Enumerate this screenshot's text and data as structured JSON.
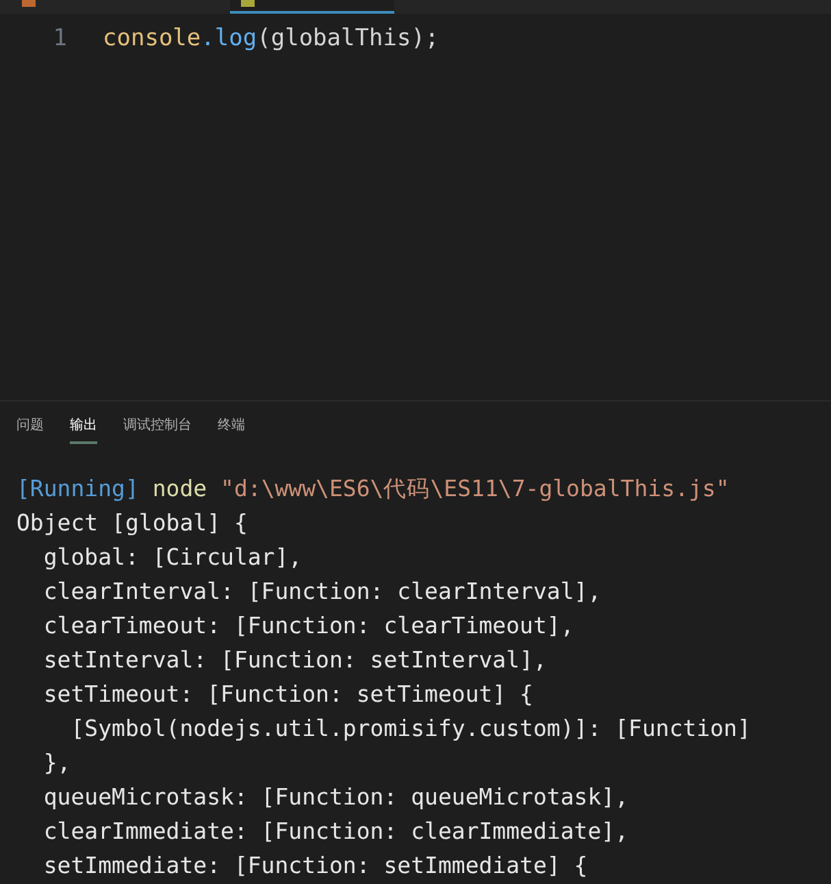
{
  "editor_tabs": [
    {
      "kind": "html",
      "selected": false
    },
    {
      "kind": "js",
      "selected": true
    }
  ],
  "code_lines": [
    {
      "number": "1",
      "tokens": [
        {
          "kind": "object",
          "text": "console"
        },
        {
          "kind": "method",
          "text": ".log"
        },
        {
          "kind": "punct",
          "text": "(globalThis);"
        }
      ]
    }
  ],
  "panel_tabs": [
    {
      "label": "问题",
      "selected": false
    },
    {
      "label": "输出",
      "selected": true
    },
    {
      "label": "调试控制台",
      "selected": false
    },
    {
      "label": "终端",
      "selected": false
    }
  ],
  "output_lines": [
    {
      "tokens": [
        {
          "kind": "status",
          "text": "[Running]"
        },
        {
          "kind": "command",
          "text": " node "
        },
        {
          "kind": "string",
          "text": "\"d:\\www\\ES6\\代码\\ES11\\7-globalThis.js\""
        }
      ]
    },
    {
      "tokens": [
        {
          "kind": "plain",
          "text": "Object [global] {"
        }
      ]
    },
    {
      "tokens": [
        {
          "kind": "plain",
          "text": "  global: [Circular],"
        }
      ]
    },
    {
      "tokens": [
        {
          "kind": "plain",
          "text": "  clearInterval: [Function: clearInterval],"
        }
      ]
    },
    {
      "tokens": [
        {
          "kind": "plain",
          "text": "  clearTimeout: [Function: clearTimeout],"
        }
      ]
    },
    {
      "tokens": [
        {
          "kind": "plain",
          "text": "  setInterval: [Function: setInterval],"
        }
      ]
    },
    {
      "tokens": [
        {
          "kind": "plain",
          "text": "  setTimeout: [Function: setTimeout] {"
        }
      ]
    },
    {
      "tokens": [
        {
          "kind": "plain",
          "text": "    [Symbol(nodejs.util.promisify.custom)]: [Function]"
        }
      ]
    },
    {
      "tokens": [
        {
          "kind": "plain",
          "text": "  },"
        }
      ]
    },
    {
      "tokens": [
        {
          "kind": "plain",
          "text": "  queueMicrotask: [Function: queueMicrotask],"
        }
      ]
    },
    {
      "tokens": [
        {
          "kind": "plain",
          "text": "  clearImmediate: [Function: clearImmediate],"
        }
      ]
    },
    {
      "tokens": [
        {
          "kind": "plain",
          "text": "  setImmediate: [Function: setImmediate] {"
        }
      ]
    }
  ]
}
